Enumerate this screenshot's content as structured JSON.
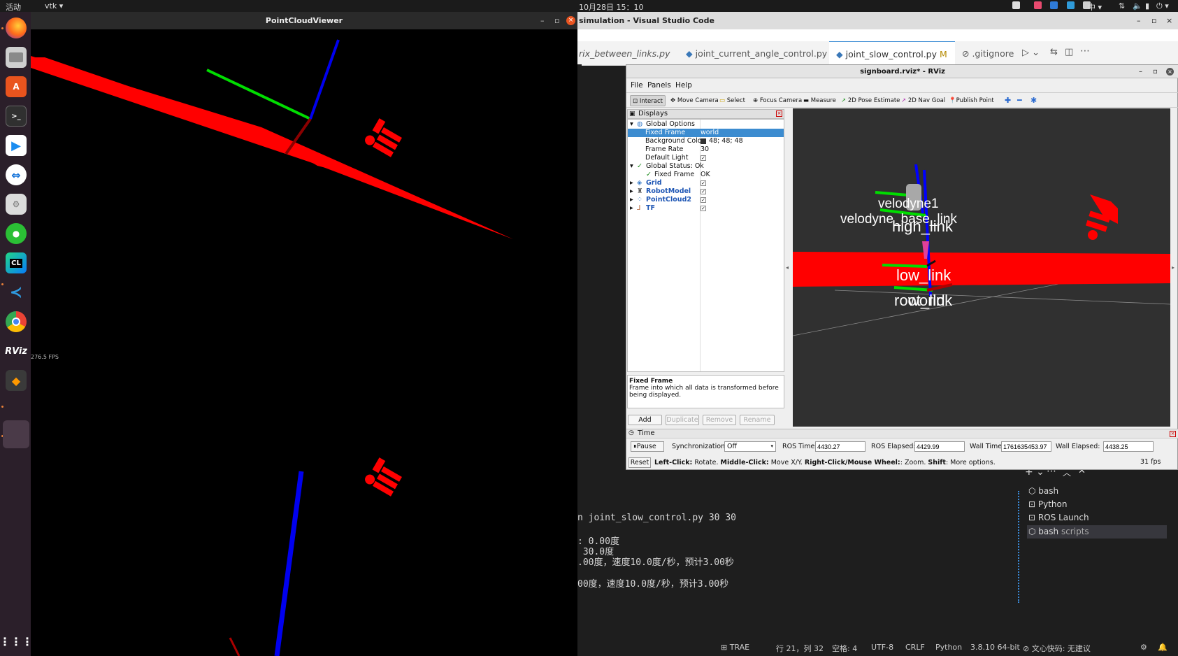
{
  "topbar": {
    "activities": "活动",
    "app_menu": "vtk",
    "datetime": "10月28日  15：10",
    "input_method": "中"
  },
  "dock": {
    "apps": [
      "Firefox",
      "Files",
      "Ubuntu Software",
      "Terminal",
      "Remote Desktop",
      "TeamViewer",
      "Settings",
      "WeChat",
      "CLion",
      "Visual Studio Code",
      "Chrome",
      "RViz",
      "Sublime Text",
      "Recent app"
    ],
    "clion_label": "CL",
    "rviz_label": "RViz"
  },
  "pointcloud_viewer": {
    "title": "PointCloudViewer",
    "fps": "276.5 FPS",
    "colors": {
      "cloud": "#ff0000",
      "x_axis": "#00cc00",
      "z_axis": "#0000ee"
    }
  },
  "vscode": {
    "title": "simulation - Visual Studio Code",
    "tabs": [
      {
        "label": "rix_between_links.py"
      },
      {
        "label": "joint_current_angle_control.py"
      },
      {
        "label": "joint_slow_control.py",
        "badge": "M",
        "active": true
      },
      {
        "label": ".gitignore"
      }
    ],
    "terminal_lines": [
      "n joint_slow_control.py 30 30",
      ": 0.00度",
      " 30.0度",
      ".00度，速度10.0度/秒，预计3.00秒",
      "00度，速度10.0度/秒，预计3.00秒"
    ],
    "terminal_list": [
      {
        "label": "bash",
        "detail": ""
      },
      {
        "label": "Python",
        "detail": ""
      },
      {
        "label": "ROS Launch",
        "detail": ""
      },
      {
        "label": "bash",
        "detail": "scripts"
      }
    ],
    "statusbar": [
      "TRAE",
      "行 21，列 32",
      "空格: 4",
      "UTF-8",
      "CRLF",
      "Python",
      "3.8.10 64-bit",
      "文心快码: 无建议"
    ]
  },
  "rviz": {
    "title": "signboard.rviz* - RViz",
    "menu": [
      "File",
      "Panels",
      "Help"
    ],
    "tools": [
      "Interact",
      "Move Camera",
      "Select",
      "Focus Camera",
      "Measure",
      "2D Pose Estimate",
      "2D Nav Goal",
      "Publish Point"
    ],
    "displays_title": "Displays",
    "tree": {
      "global_options": "Global Options",
      "fixed_frame_label": "Fixed Frame",
      "fixed_frame_value": "world",
      "bg_color_label": "Background Color",
      "bg_color_value": "48; 48; 48",
      "frame_rate_label": "Frame Rate",
      "frame_rate_value": "30",
      "default_light_label": "Default Light",
      "global_status": "Global Status: Ok",
      "status_fixed_frame": "Fixed Frame",
      "status_ok": "OK",
      "grid": "Grid",
      "robot_model": "RobotModel",
      "pointcloud2": "PointCloud2",
      "tf": "TF"
    },
    "desc_title": "Fixed Frame",
    "desc_text": "Frame into which all data is transformed before being displayed.",
    "buttons": [
      "Add",
      "Duplicate",
      "Remove",
      "Rename"
    ],
    "view_labels": {
      "velodyne1": "velodyne1",
      "velodyne_base": "velodyne_base_link",
      "high_link": "high_link",
      "low_link": "low_link",
      "root_link": "root_link",
      "world": "world"
    },
    "time": {
      "title": "Time",
      "pause": "Pause",
      "sync_label": "Synchronization:",
      "sync_value": "Off",
      "ros_time_label": "ROS Time:",
      "ros_time": "4430.27",
      "ros_elapsed_label": "ROS Elapsed:",
      "ros_elapsed": "4429.99",
      "wall_time_label": "Wall Time:",
      "wall_time": "1761635453.97",
      "wall_elapsed_label": "Wall Elapsed:",
      "wall_elapsed": "4438.25",
      "reset": "Reset",
      "hint_b1": "Left-Click:",
      "hint_t1": " Rotate. ",
      "hint_b2": "Middle-Click:",
      "hint_t2": " Move X/Y. ",
      "hint_b3": "Right-Click/Mouse Wheel:",
      "hint_t3": ": Zoom. ",
      "hint_b4": "Shift",
      "hint_t4": ": More options.",
      "fps": "31 fps"
    }
  }
}
